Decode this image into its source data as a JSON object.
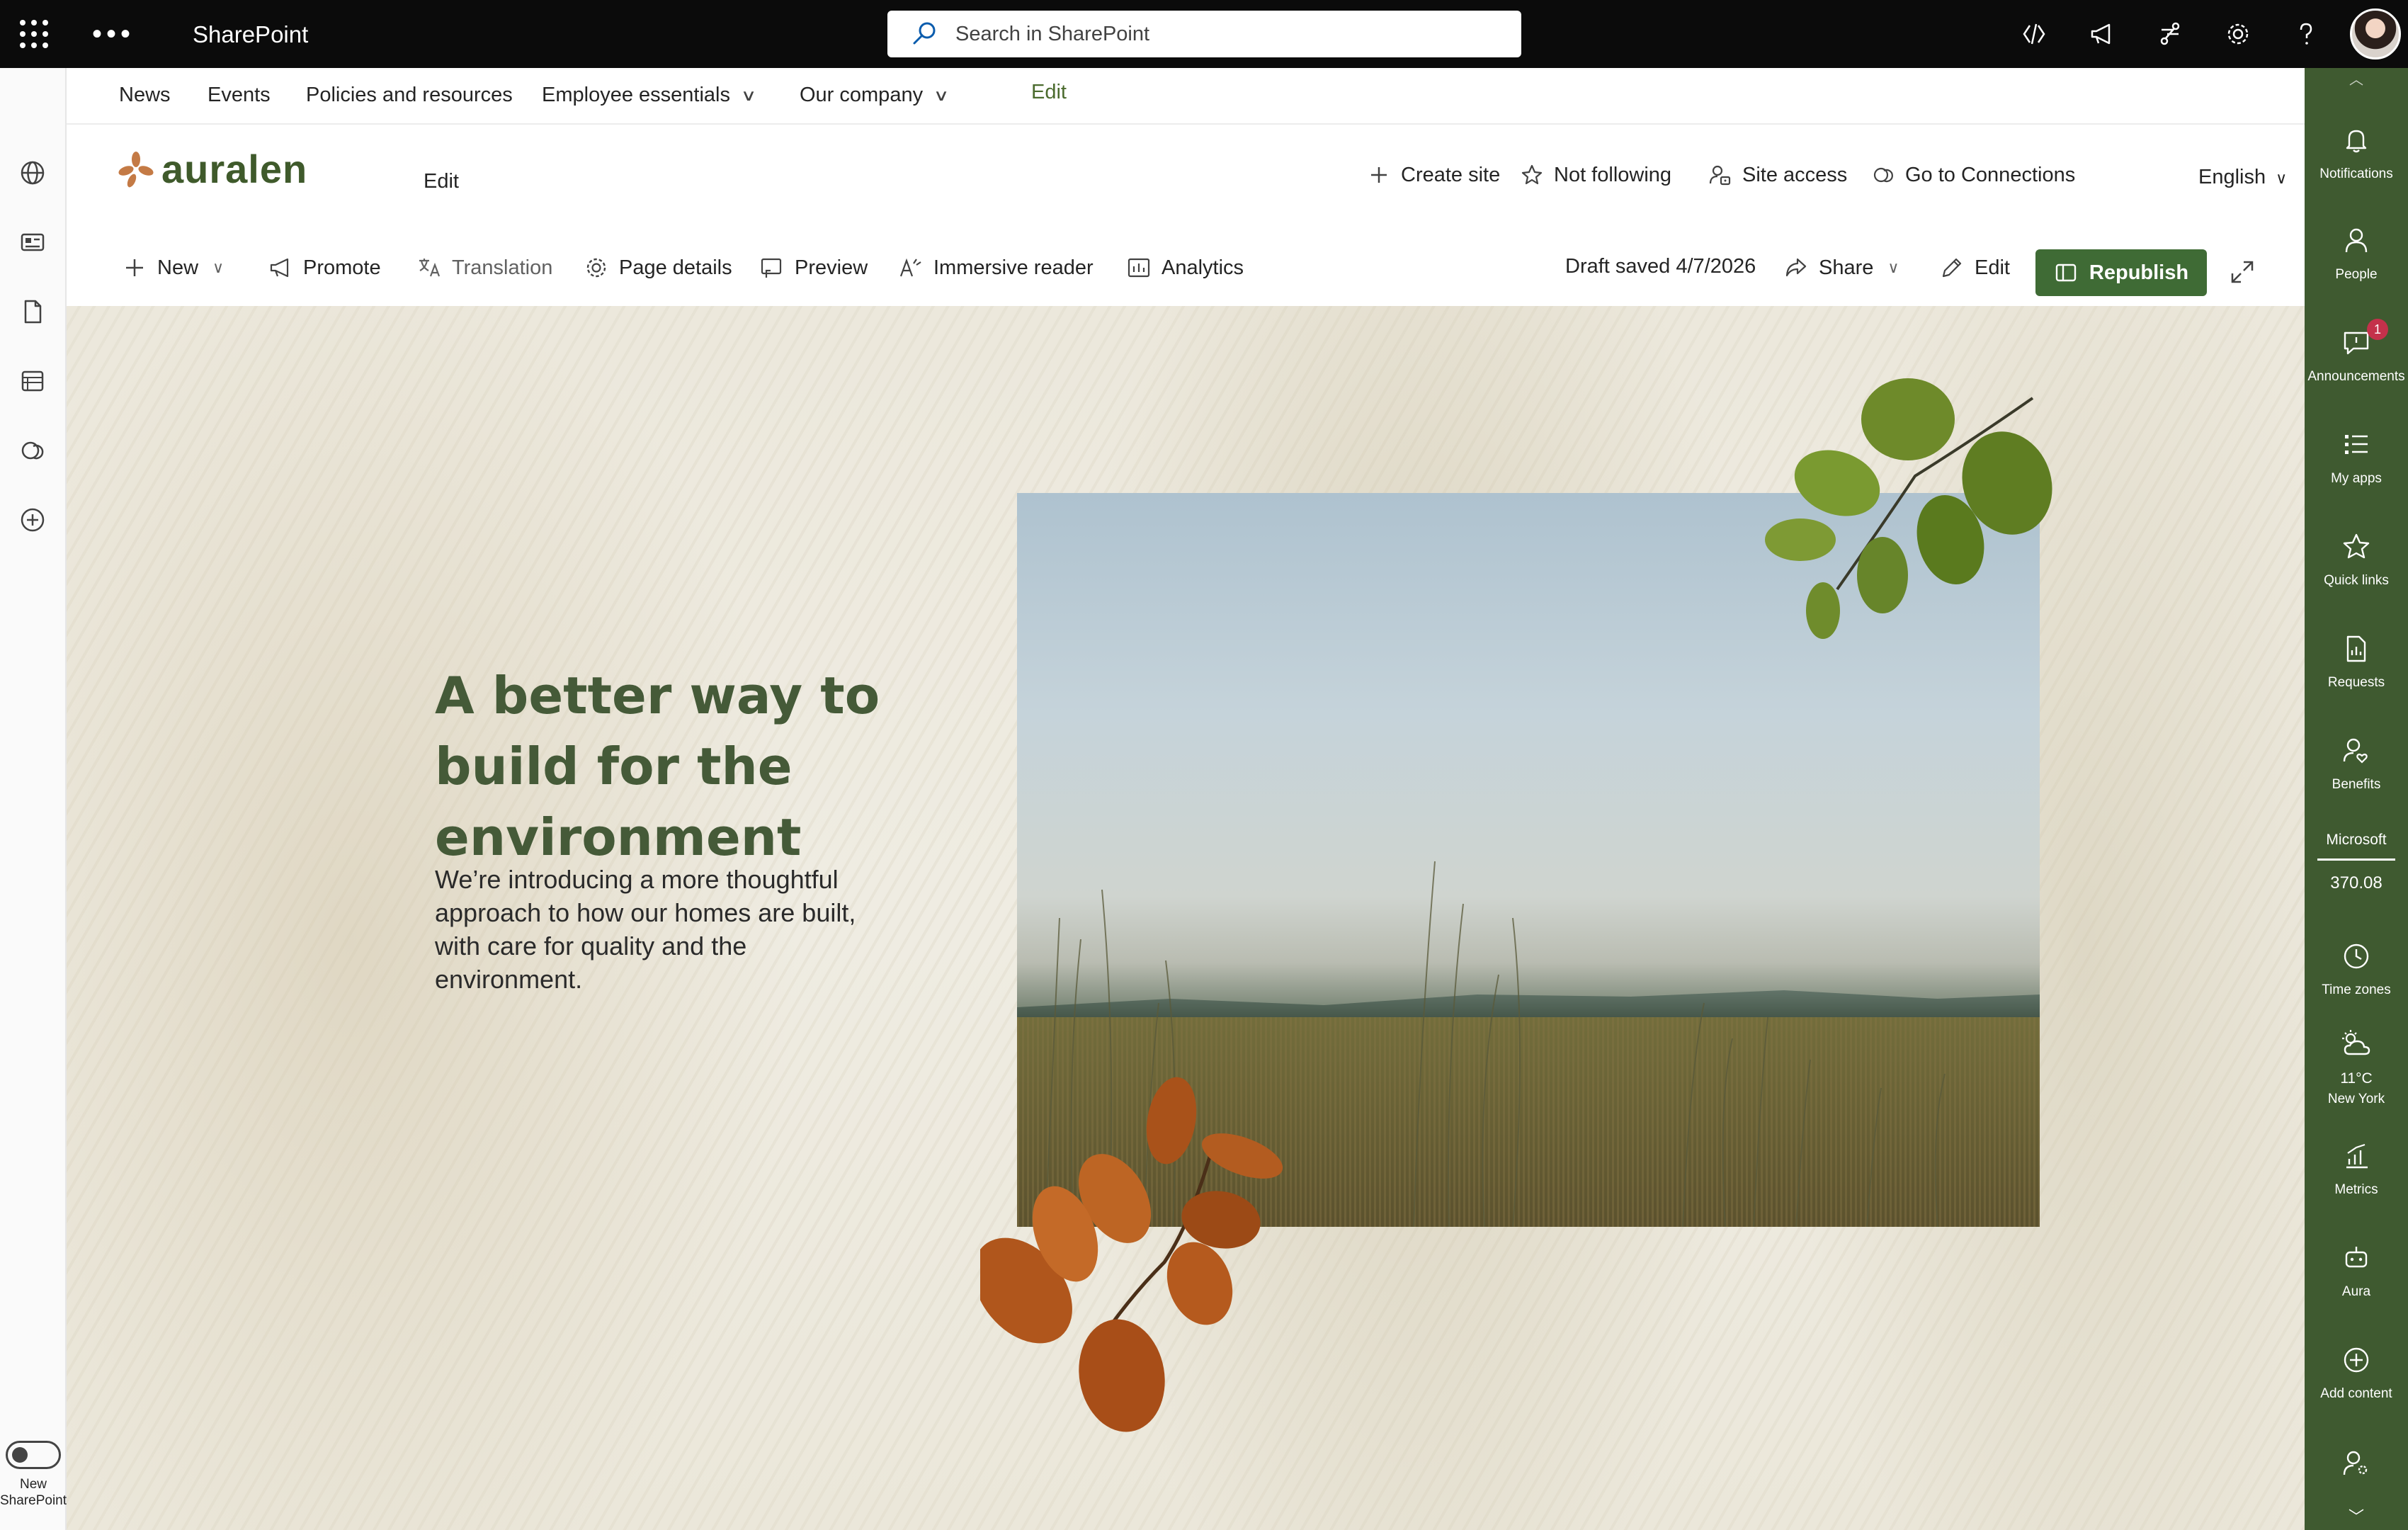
{
  "suite": {
    "app_name": "SharePoint",
    "search_placeholder": "Search in SharePoint",
    "icons": [
      "app-launcher-icon",
      "more-icon",
      "code-icon",
      "megaphone-icon",
      "share-icon",
      "settings-icon",
      "help-icon"
    ]
  },
  "left_rail": {
    "icons": [
      "globe-icon",
      "news-icon",
      "document-icon",
      "list-icon",
      "loop-icon",
      "add-circle-icon"
    ],
    "toggle_label_line1": "New",
    "toggle_label_line2": "SharePoint"
  },
  "hub_nav": {
    "items": [
      "News",
      "Events",
      "Policies and resources",
      "Employee essentials",
      "Our company"
    ],
    "edit_label": "Edit"
  },
  "site_header": {
    "logo_text": "auralen",
    "edit_label": "Edit",
    "actions": [
      "Create site",
      "Not following",
      "Site access",
      "Go to Connections"
    ],
    "language": "English"
  },
  "command_bar": {
    "new": "New",
    "promote": "Promote",
    "translation": "Translation",
    "page_details": "Page details",
    "preview": "Preview",
    "immersive_reader": "Immersive reader",
    "analytics": "Analytics",
    "draft_status": "Draft saved 4/7/2026",
    "share": "Share",
    "edit": "Edit",
    "republish": "Republish"
  },
  "hero": {
    "title": "A better way to build for the environment",
    "body": "We’re introducing a more thoughtful approach to how our homes are built, with care for quality and the environment."
  },
  "right_rail": {
    "items": [
      {
        "label": "Notifications",
        "icon": "bell-icon"
      },
      {
        "label": "People",
        "icon": "person-icon"
      },
      {
        "label": "Announcements",
        "icon": "chat-icon",
        "badge": "1"
      },
      {
        "label": "My apps",
        "icon": "apps-list-icon"
      },
      {
        "label": "Quick links",
        "icon": "star-icon"
      },
      {
        "label": "Requests",
        "icon": "request-doc-icon"
      },
      {
        "label": "Benefits",
        "icon": "benefits-person-icon"
      }
    ],
    "stock_name": "Microsoft",
    "stock_value": "370.08",
    "time_zones": "Time zones",
    "weather_temp": "11°C",
    "weather_city": "New York",
    "metrics": "Metrics",
    "aura": "Aura",
    "add_content": "Add content"
  },
  "colors": {
    "accent": "#3f6b35",
    "title_green": "#455a38",
    "suite_bar": "#0b0b0b",
    "rail_bg": "#3f5a30",
    "badge": "#c4314b"
  }
}
